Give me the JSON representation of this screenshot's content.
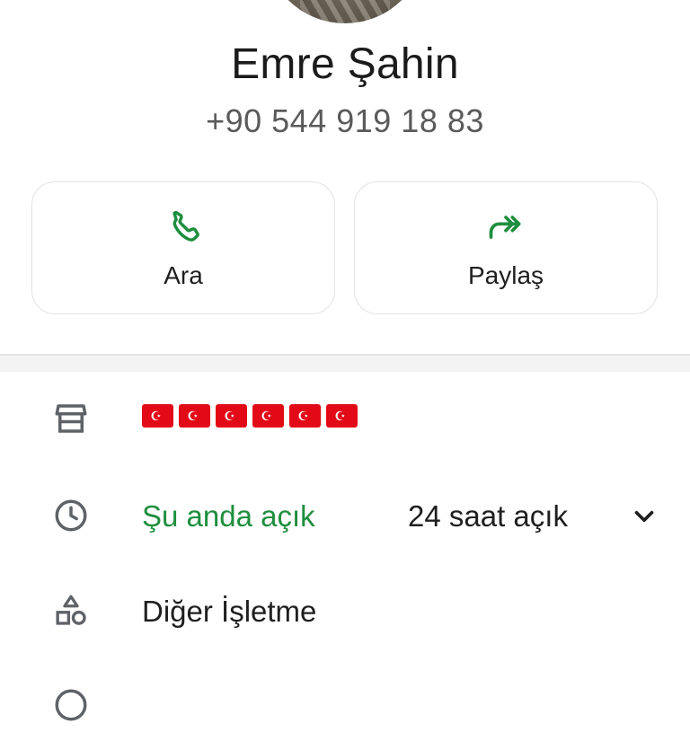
{
  "contact": {
    "name": "Emre Şahin",
    "phone": "+90 544 919 18 83"
  },
  "actions": {
    "call_label": "Ara",
    "share_label": "Paylaş"
  },
  "details": {
    "store_flags": [
      "🇹🇷",
      "🇹🇷",
      "🇹🇷",
      "🇹🇷",
      "🇹🇷",
      "🇹🇷"
    ],
    "open_status": "Şu anda açık",
    "hours": "24 saat açık",
    "category": "Diğer İşletme"
  },
  "colors": {
    "accent_green": "#1e8e3e",
    "icon_gray": "#5f6368"
  },
  "icons": {
    "call": "phone-icon",
    "share": "forward-arrows-icon",
    "store": "storefront-icon",
    "hours": "clock-icon",
    "expand": "chevron-down-icon",
    "category": "shapes-icon"
  }
}
